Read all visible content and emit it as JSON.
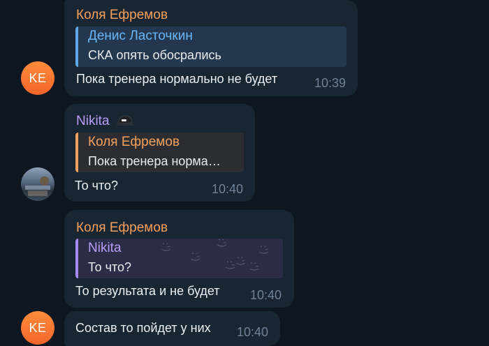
{
  "messages": [
    {
      "sender": "Коля Ефремов",
      "reply": {
        "name": "Денис Ласточкин",
        "text": "СКА опять обосрались"
      },
      "text": "Пока тренера нормально не будет",
      "time": "10:39"
    },
    {
      "sender": "Nikita",
      "reply": {
        "name": "Коля Ефремов",
        "text": "Пока тренера норма…"
      },
      "text": "То что?",
      "time": "10:40"
    },
    {
      "sender": "Коля Ефремов",
      "reply": {
        "name": "Nikita",
        "text": "То что?"
      },
      "text": "То результата и не будет",
      "time": "10:40"
    },
    {
      "text": "Состав то пойдет у них",
      "time": "10:40"
    }
  ],
  "avatars": {
    "kolya_initials": "KE"
  },
  "reply_pattern": [
    ":')",
    ":')",
    ":')",
    ":')",
    ":')",
    ":')",
    ":')"
  ],
  "colors": {
    "background": "#0e1621",
    "bubble": "#182533",
    "sender_orange": "#f5a05a",
    "sender_purple": "#b89cf6",
    "reply_blue": "#6ab5f5",
    "time": "#6f8296"
  },
  "icons": {
    "nikita_badge": "cap-icon"
  }
}
